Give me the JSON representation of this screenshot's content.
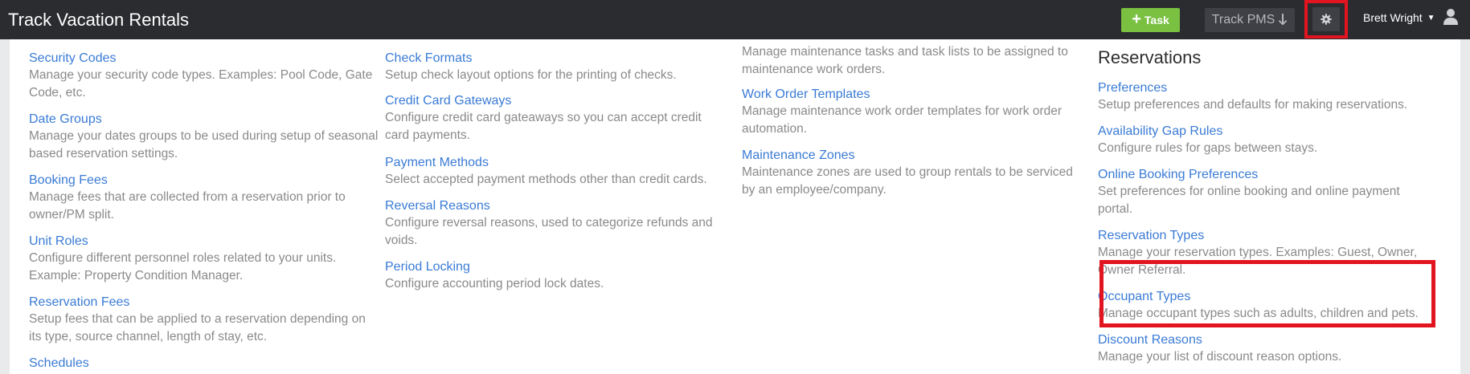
{
  "header": {
    "app_title": "Track Vacation Rentals",
    "task_button": "Task",
    "pms_button": "Track PMS",
    "user_name": "Brett Wright",
    "icons": [
      "plus-icon",
      "download-arrow-icon",
      "gear-icon",
      "caret-down-icon",
      "user-icon"
    ]
  },
  "col1": {
    "partial_top": "",
    "items": [
      {
        "link": "Security Codes",
        "desc": "Manage your security code types. Examples: Pool Code, Gate Code, etc."
      },
      {
        "link": "Date Groups",
        "desc": "Manage your dates groups to be used during setup of seasonal based reservation settings."
      },
      {
        "link": "Booking Fees",
        "desc": "Manage fees that are collected from a reservation prior to owner/PM split."
      },
      {
        "link": "Unit Roles",
        "desc": "Configure different personnel roles related to your units. Example: Property Condition Manager."
      },
      {
        "link": "Reservation Fees",
        "desc": "Setup fees that can be applied to a reservation depending on its type, source channel, length of stay, etc."
      },
      {
        "link": "Schedules",
        "desc": ""
      }
    ]
  },
  "col2": {
    "items": [
      {
        "link": "Check Formats",
        "desc": "Setup check layout options for the printing of checks."
      },
      {
        "link": "Credit Card Gateways",
        "desc": "Configure credit card gateaways so you can accept credit card payments."
      },
      {
        "link": "Payment Methods",
        "desc": "Select accepted payment methods other than credit cards."
      },
      {
        "link": "Reversal Reasons",
        "desc": "Configure reversal reasons, used to categorize refunds and voids."
      },
      {
        "link": "Period Locking",
        "desc": "Configure accounting period lock dates."
      }
    ]
  },
  "col3": {
    "items": [
      {
        "link": "",
        "desc": "Manage maintenance tasks and task lists to be assigned to maintenance work orders."
      },
      {
        "link": "Work Order Templates",
        "desc": "Manage maintenance work order templates for work order automation."
      },
      {
        "link": "Maintenance Zones",
        "desc": "Maintenance zones are used to group rentals to be serviced by an employee/company."
      }
    ]
  },
  "col4": {
    "section_title": "Reservations",
    "items": [
      {
        "link": "Preferences",
        "desc": "Setup preferences and defaults for making reservations."
      },
      {
        "link": "Availability Gap Rules",
        "desc": "Configure rules for gaps between stays."
      },
      {
        "link": "Online Booking Preferences",
        "desc": "Set preferences for online booking and online payment portal."
      },
      {
        "link": "Reservation Types",
        "desc": "Manage your reservation types. Examples: Guest, Owner, Owner Referral."
      },
      {
        "link": "Occupant Types",
        "desc": "Manage occupant types such as adults, children and pets."
      },
      {
        "link": "Discount Reasons",
        "desc": "Manage your list of discount reason options."
      }
    ]
  }
}
